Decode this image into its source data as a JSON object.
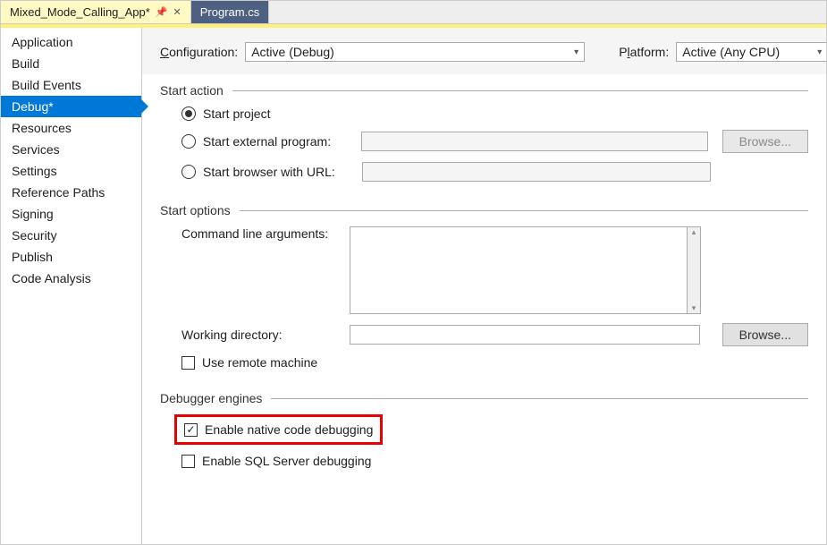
{
  "tabs": [
    {
      "label": "Mixed_Mode_Calling_App*",
      "active": true
    },
    {
      "label": "Program.cs",
      "active": false
    }
  ],
  "sidebar": {
    "items": [
      "Application",
      "Build",
      "Build Events",
      "Debug*",
      "Resources",
      "Services",
      "Settings",
      "Reference Paths",
      "Signing",
      "Security",
      "Publish",
      "Code Analysis"
    ],
    "selected_index": 3
  },
  "config_bar": {
    "configuration_label": "Configuration:",
    "configuration_value": "Active (Debug)",
    "platform_label": "Platform:",
    "platform_value": "Active (Any CPU)"
  },
  "start_action": {
    "title": "Start action",
    "options": {
      "start_project": "Start project",
      "start_external": "Start external program:",
      "start_browser": "Start browser with URL:"
    },
    "selected": "start_project",
    "browse_label": "Browse..."
  },
  "start_options": {
    "title": "Start options",
    "cmd_args_label": "Command line arguments:",
    "cmd_args_value": "",
    "working_dir_label": "Working directory:",
    "working_dir_value": "",
    "browse_label": "Browse...",
    "remote_label": "Use remote machine",
    "remote_checked": false
  },
  "debugger_engines": {
    "title": "Debugger engines",
    "native_label": "Enable native code debugging",
    "native_checked": true,
    "sql_label": "Enable SQL Server debugging",
    "sql_checked": false
  }
}
